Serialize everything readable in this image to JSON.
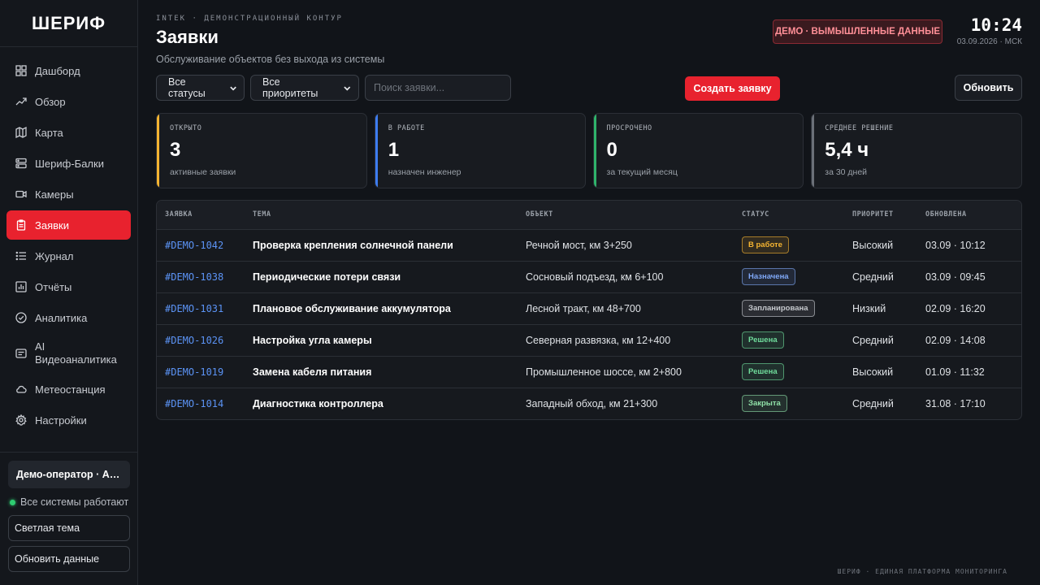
{
  "sidebar": {
    "logo": "ШЕРИФ",
    "items": [
      {
        "label": "Дашборд",
        "icon": "grid-icon"
      },
      {
        "label": "Обзор",
        "icon": "trend-icon"
      },
      {
        "label": "Карта",
        "icon": "map-icon"
      },
      {
        "label": "Шериф-Балки",
        "icon": "server-icon"
      },
      {
        "label": "Камеры",
        "icon": "camera-icon"
      },
      {
        "label": "Заявки",
        "icon": "clipboard-icon",
        "active": true
      },
      {
        "label": "Журнал",
        "icon": "list-icon"
      },
      {
        "label": "Отчёты",
        "icon": "bar-chart-icon"
      },
      {
        "label": "Аналитика",
        "icon": "check-circle-icon"
      },
      {
        "label": "AI Видеоаналитика",
        "icon": "video-ai-icon"
      },
      {
        "label": "Метеостанция",
        "icon": "cloud-icon"
      },
      {
        "label": "Настройки",
        "icon": "gear-icon"
      }
    ],
    "user": "Демо-оператор · Адм",
    "system_status": "Все системы работают",
    "theme_button": "Светлая тема",
    "refresh_data_button": "Обновить данные"
  },
  "header": {
    "eyebrow": "INTEK · ДЕМОНСТРАЦИОННЫЙ КОНТУР",
    "title": "Заявки",
    "subtitle": "Обслуживание объектов без выхода из системы",
    "demo_badge": "ДЕМО · ВЫМЫШЛЕННЫЕ ДАННЫЕ",
    "time": "10:24",
    "date": "03.09.2026 · МСК"
  },
  "filters": {
    "status_select": "Все статусы",
    "priority_select": "Все приоритеты",
    "search_placeholder": "Поиск заявки...",
    "create_button": "Создать заявку",
    "refresh_button": "Обновить"
  },
  "stats": [
    {
      "label": "ОТКРЫТО",
      "value": "3",
      "caption": "активные заявки",
      "accent": "#f5b431"
    },
    {
      "label": "В РАБОТЕ",
      "value": "1",
      "caption": "назначен инженер",
      "accent": "#3d7cf0"
    },
    {
      "label": "ПРОСРОЧЕНО",
      "value": "0",
      "caption": "за текущий месяц",
      "accent": "#2fb36b"
    },
    {
      "label": "СРЕДНЕЕ РЕШЕНИЕ",
      "value": "5,4 ч",
      "caption": "за 30 дней",
      "accent": "#6b7078"
    }
  ],
  "table": {
    "headers": [
      "ЗАЯВКА",
      "ТЕМА",
      "ОБЪЕКТ",
      "СТАТУС",
      "ПРИОРИТЕТ",
      "ОБНОВЛЕНА"
    ],
    "rows": [
      {
        "id": "#DEMO-1042",
        "subject": "Проверка крепления солнечной панели",
        "object": "Речной мост, км 3+250",
        "status": "В работе",
        "status_color": "#f5b431",
        "priority": "Высокий",
        "updated": "03.09 · 10:12"
      },
      {
        "id": "#DEMO-1038",
        "subject": "Периодические потери связи",
        "object": "Сосновый подъезд, км 6+100",
        "status": "Назначена",
        "status_color": "#7fa8f7",
        "priority": "Средний",
        "updated": "03.09 · 09:45"
      },
      {
        "id": "#DEMO-1031",
        "subject": "Плановое обслуживание аккумулятора",
        "object": "Лесной тракт, км 48+700",
        "status": "Запланирована",
        "status_color": "#c6c9ce",
        "priority": "Низкий",
        "updated": "02.09 · 16:20"
      },
      {
        "id": "#DEMO-1026",
        "subject": "Настройка угла камеры",
        "object": "Северная развязка, км 12+400",
        "status": "Решена",
        "status_color": "#6fdc9b",
        "priority": "Средний",
        "updated": "02.09 · 14:08"
      },
      {
        "id": "#DEMO-1019",
        "subject": "Замена кабеля питания",
        "object": "Промышленное шоссе, км 2+800",
        "status": "Решена",
        "status_color": "#6fdc9b",
        "priority": "Высокий",
        "updated": "01.09 · 11:32"
      },
      {
        "id": "#DEMO-1014",
        "subject": "Диагностика контроллера",
        "object": "Западный обход, км 21+300",
        "status": "Закрыта",
        "status_color": "#8fe0a7",
        "priority": "Средний",
        "updated": "31.08 · 17:10"
      }
    ]
  },
  "footer": "ШЕРИФ · ЕДИНАЯ ПЛАТФОРМА МОНИТОРИНГА"
}
